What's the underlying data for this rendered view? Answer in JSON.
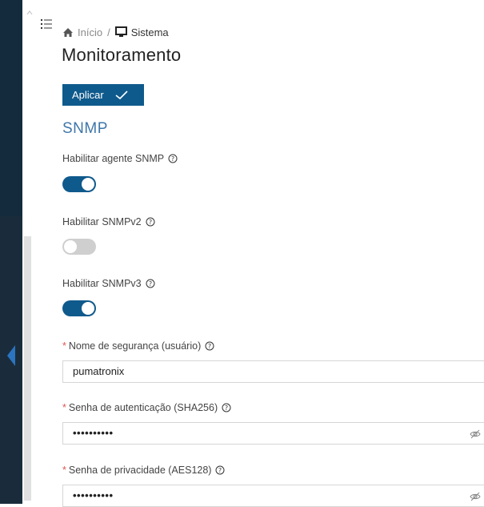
{
  "breadcrumb": {
    "home": "Início",
    "separator": "/",
    "current": "Sistema"
  },
  "page": {
    "title": "Monitoramento"
  },
  "toolbar": {
    "apply_label": "Aplicar"
  },
  "snmp": {
    "section_title": "SNMP",
    "enable_agent_label": "Habilitar agente SNMP",
    "enable_agent_on": true,
    "enable_v2_label": "Habilitar SNMPv2",
    "enable_v2_on": false,
    "enable_v3_label": "Habilitar SNMPv3",
    "enable_v3_on": true,
    "security_name_label": "Nome de segurança (usuário)",
    "security_name_value": "pumatronix",
    "auth_password_label": "Senha de autenticação (SHA256)",
    "auth_password_value": "••••••••••",
    "priv_password_label": "Senha de privacidade (AES128)",
    "priv_password_value": "••••••••••"
  },
  "colors": {
    "primary": "#0f5a8c",
    "section": "#3f76a8",
    "required": "#e0574f",
    "sidebar": "#1a2c3c"
  },
  "icons": [
    "menu-icon",
    "home-icon",
    "monitor-icon",
    "check-icon",
    "help-icon",
    "eye-off-icon",
    "chevron-left-icon",
    "caret-up-icon"
  ]
}
